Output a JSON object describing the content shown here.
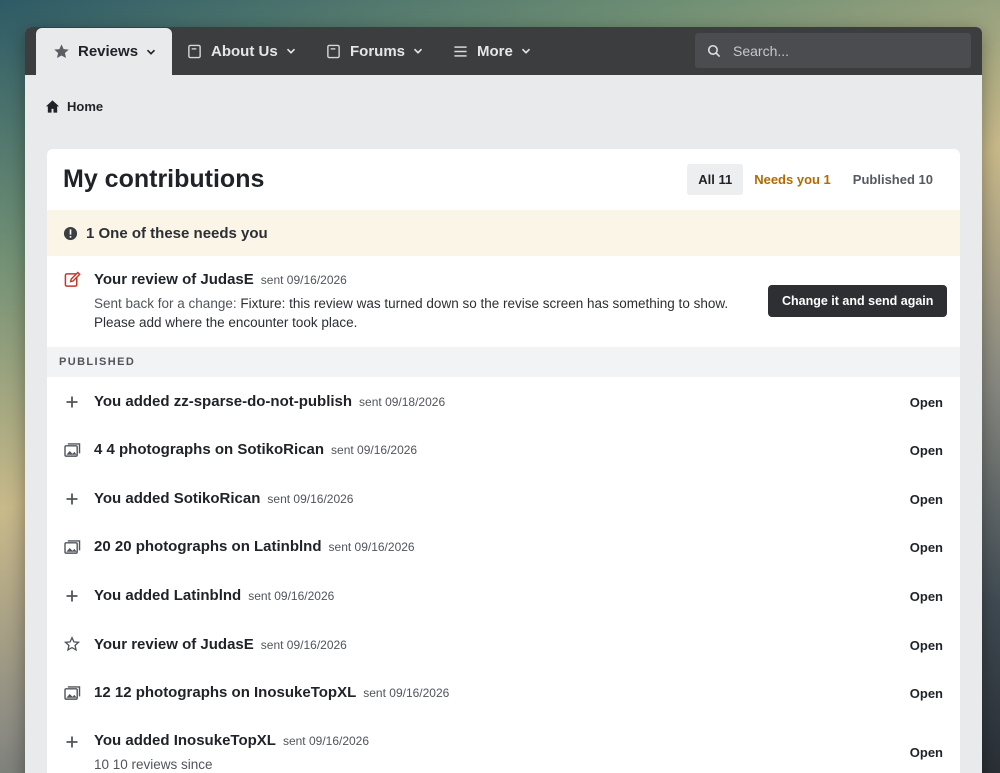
{
  "nav": {
    "tabs": [
      {
        "label": "Reviews",
        "icon": "star-icon"
      },
      {
        "label": "About Us",
        "icon": "book-icon"
      },
      {
        "label": "Forums",
        "icon": "book-icon"
      },
      {
        "label": "More",
        "icon": "menu-icon"
      }
    ],
    "search_placeholder": "Search..."
  },
  "breadcrumb": {
    "home": "Home"
  },
  "page": {
    "title": "My contributions",
    "filters": [
      {
        "label": "All 11",
        "active": true
      },
      {
        "label": "Needs you 1",
        "active": false
      },
      {
        "label": "Published 10",
        "active": false
      }
    ]
  },
  "needs": {
    "banner": "1 One of these needs you",
    "item": {
      "title": "Your review of JudasE",
      "meta": "sent 09/16/2026",
      "message_label": "Sent back for a change:",
      "message": "Fixture: this review was turned down so the revise screen has something to show. Please add where the encounter took place.",
      "button": "Change it and send again"
    }
  },
  "published": {
    "label": "PUBLISHED",
    "open_label": "Open",
    "items": [
      {
        "icon": "plus-icon",
        "title": "You added zz-sparse-do-not-publish",
        "meta": "sent 09/18/2026"
      },
      {
        "icon": "photos-icon",
        "title": "4 4 photographs on SotikoRican",
        "meta": "sent 09/16/2026"
      },
      {
        "icon": "plus-icon",
        "title": "You added SotikoRican",
        "meta": "sent 09/16/2026"
      },
      {
        "icon": "photos-icon",
        "title": "20 20 photographs on Latinblnd",
        "meta": "sent 09/16/2026"
      },
      {
        "icon": "plus-icon",
        "title": "You added Latinblnd",
        "meta": "sent 09/16/2026"
      },
      {
        "icon": "star-outline-icon",
        "title": "Your review of JudasE",
        "meta": "sent 09/16/2026"
      },
      {
        "icon": "photos-icon",
        "title": "12 12 photographs on InosukeTopXL",
        "meta": "sent 09/16/2026"
      },
      {
        "icon": "plus-icon",
        "title": "You added InosukeTopXL",
        "meta": "sent 09/16/2026",
        "sub": "10 10 reviews since"
      }
    ]
  }
}
